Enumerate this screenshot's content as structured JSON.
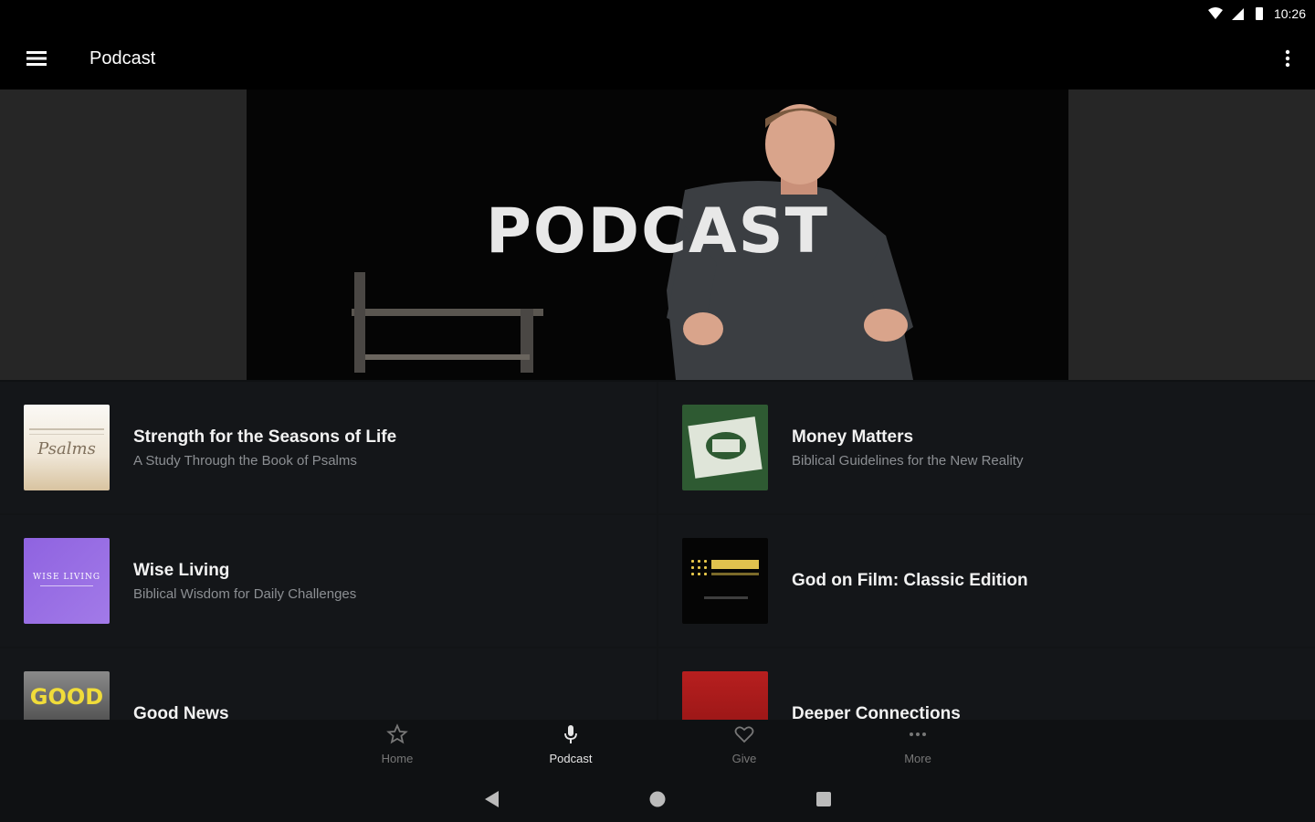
{
  "status_bar": {
    "time": "10:26"
  },
  "app_bar": {
    "title": "Podcast"
  },
  "hero": {
    "title": "PODCAST"
  },
  "podcasts": [
    {
      "title": "Strength for the Seasons of Life",
      "subtitle": "A Study Through the Book of Psalms"
    },
    {
      "title": "Money Matters",
      "subtitle": "Biblical Guidelines for the New Reality"
    },
    {
      "title": "Wise Living",
      "subtitle": "Biblical Wisdom for Daily Challenges"
    },
    {
      "title": "God on Film: Classic Edition",
      "subtitle": ""
    },
    {
      "title": "Good News",
      "subtitle": ""
    },
    {
      "title": "Deeper Connections",
      "subtitle": ""
    }
  ],
  "thumbs": {
    "psalms_script": "Psalms",
    "wise_living": "WISE LIVING",
    "good": "GOOD"
  },
  "bottom_nav": [
    {
      "label": "Home",
      "icon": "star-icon"
    },
    {
      "label": "Podcast",
      "icon": "microphone-icon"
    },
    {
      "label": "Give",
      "icon": "heart-icon"
    },
    {
      "label": "More",
      "icon": "more-horizontal-icon"
    }
  ],
  "colors": {
    "background": "#0f1113",
    "card": "#141619",
    "active": "#e6e6e6",
    "inactive": "#777777"
  }
}
